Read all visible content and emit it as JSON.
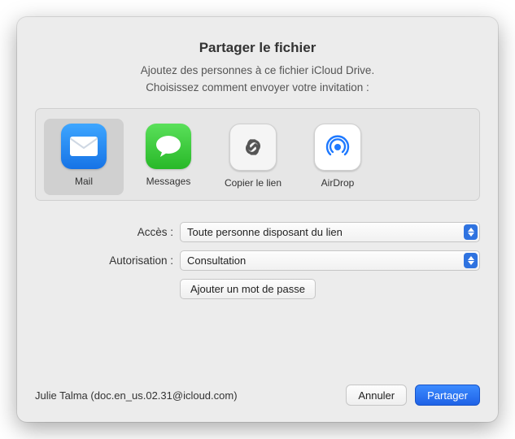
{
  "header": {
    "title": "Partager le fichier",
    "subtitle": "Ajoutez des personnes à ce fichier iCloud Drive.",
    "instruction": "Choisissez comment envoyer votre invitation :"
  },
  "methods": [
    {
      "id": "mail",
      "label": "Mail",
      "selected": true
    },
    {
      "id": "messages",
      "label": "Messages",
      "selected": false
    },
    {
      "id": "copylink",
      "label": "Copier le lien",
      "selected": false
    },
    {
      "id": "airdrop",
      "label": "AirDrop",
      "selected": false
    }
  ],
  "form": {
    "access_label": "Accès :",
    "access_value": "Toute personne disposant du lien",
    "permission_label": "Autorisation :",
    "permission_value": "Consultation",
    "add_password": "Ajouter un mot de passe"
  },
  "footer": {
    "account": "Julie Talma (doc.en_us.02.31@icloud.com)",
    "cancel": "Annuler",
    "share": "Partager"
  }
}
